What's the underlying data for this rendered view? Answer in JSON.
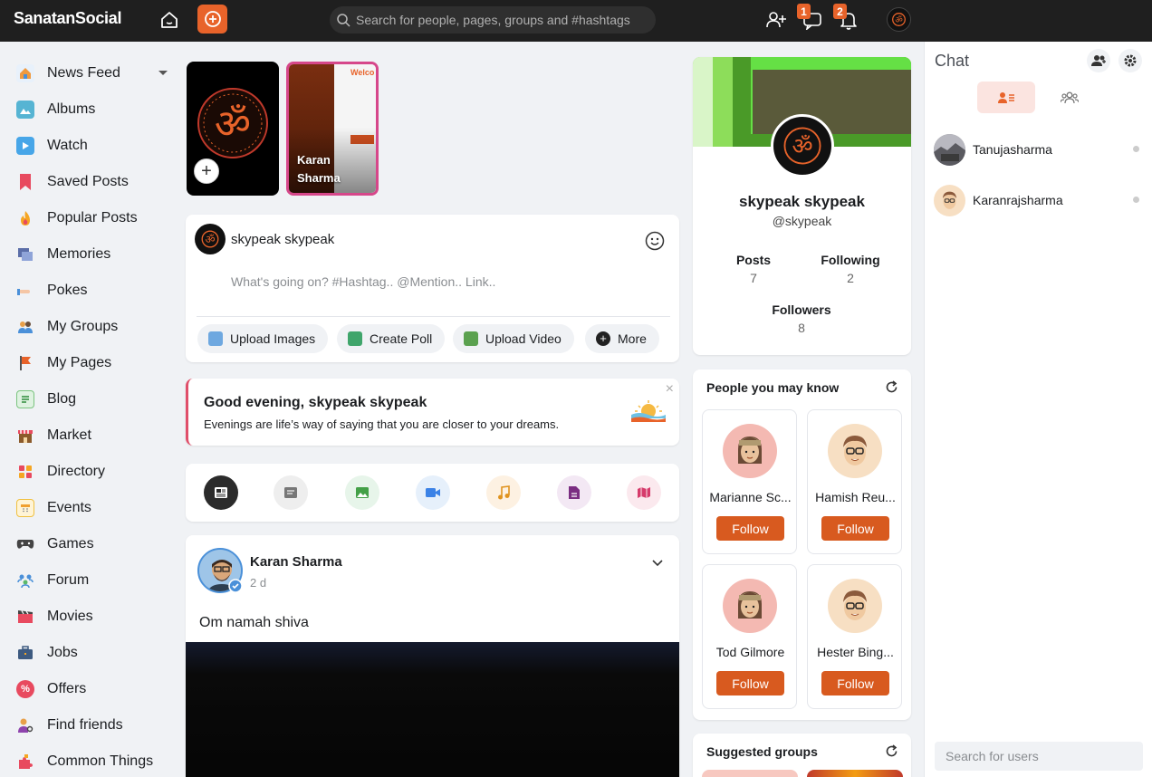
{
  "app": {
    "logo": "SanatanSocial",
    "search_placeholder": "Search for people, pages, groups and #hashtags",
    "badges": {
      "messages": "1",
      "notifications": "2"
    }
  },
  "sidebar": {
    "items": [
      {
        "label": "News Feed",
        "icon": "news-feed-icon"
      },
      {
        "label": "Albums",
        "icon": "albums-icon"
      },
      {
        "label": "Watch",
        "icon": "watch-icon"
      },
      {
        "label": "Saved Posts",
        "icon": "bookmark-icon"
      },
      {
        "label": "Popular Posts",
        "icon": "fire-icon"
      },
      {
        "label": "Memories",
        "icon": "memories-icon"
      },
      {
        "label": "Pokes",
        "icon": "poke-icon"
      },
      {
        "label": "My Groups",
        "icon": "groups-icon"
      },
      {
        "label": "My Pages",
        "icon": "flag-icon"
      },
      {
        "label": "Blog",
        "icon": "blog-icon"
      },
      {
        "label": "Market",
        "icon": "market-icon"
      },
      {
        "label": "Directory",
        "icon": "directory-icon"
      },
      {
        "label": "Events",
        "icon": "calendar-icon"
      },
      {
        "label": "Games",
        "icon": "gamepad-icon"
      },
      {
        "label": "Forum",
        "icon": "forum-icon"
      },
      {
        "label": "Movies",
        "icon": "movies-icon"
      },
      {
        "label": "Jobs",
        "icon": "briefcase-icon"
      },
      {
        "label": "Offers",
        "icon": "offers-icon"
      },
      {
        "label": "Find friends",
        "icon": "find-friends-icon"
      },
      {
        "label": "Common Things",
        "icon": "puzzle-icon"
      }
    ]
  },
  "stories": {
    "second_name": "Karan Sharma",
    "second_preview_text": "Welco"
  },
  "composer": {
    "user_name": "skypeak skypeak",
    "placeholder": "What's going on? #Hashtag.. @Mention.. Link..",
    "buttons": {
      "upload_images": "Upload Images",
      "create_poll": "Create Poll",
      "upload_video": "Upload Video",
      "more": "More"
    }
  },
  "greeting": {
    "title": "Good evening, skypeak skypeak",
    "subtitle": "Evenings are life’s way of saying that you are closer to your dreams.",
    "close": "×"
  },
  "post": {
    "author": "Karan Sharma",
    "time": "2 d",
    "text": "Om namah shiva"
  },
  "profile": {
    "name": "skypeak skypeak",
    "handle": "@skypeak",
    "posts_label": "Posts",
    "posts_value": "7",
    "following_label": "Following",
    "following_value": "2",
    "followers_label": "Followers",
    "followers_value": "8"
  },
  "pymk": {
    "title": "People you may know",
    "follow_label": "Follow",
    "people": [
      {
        "name": "Marianne Sc..."
      },
      {
        "name": "Hamish Reu..."
      },
      {
        "name": "Tod Gilmore"
      },
      {
        "name": "Hester Bing..."
      }
    ]
  },
  "suggested_groups": {
    "title": "Suggested groups"
  },
  "chat": {
    "title": "Chat",
    "users": [
      {
        "name": "Tanujasharma"
      },
      {
        "name": "Karanrajsharma"
      }
    ],
    "search_placeholder": "Search for users"
  },
  "colors": {
    "accent": "#e8632a",
    "follow_button": "#d85a1f",
    "topbar": "#1f1f1f",
    "story_border": "#d6478a",
    "greeting_border": "#e04f6a"
  }
}
